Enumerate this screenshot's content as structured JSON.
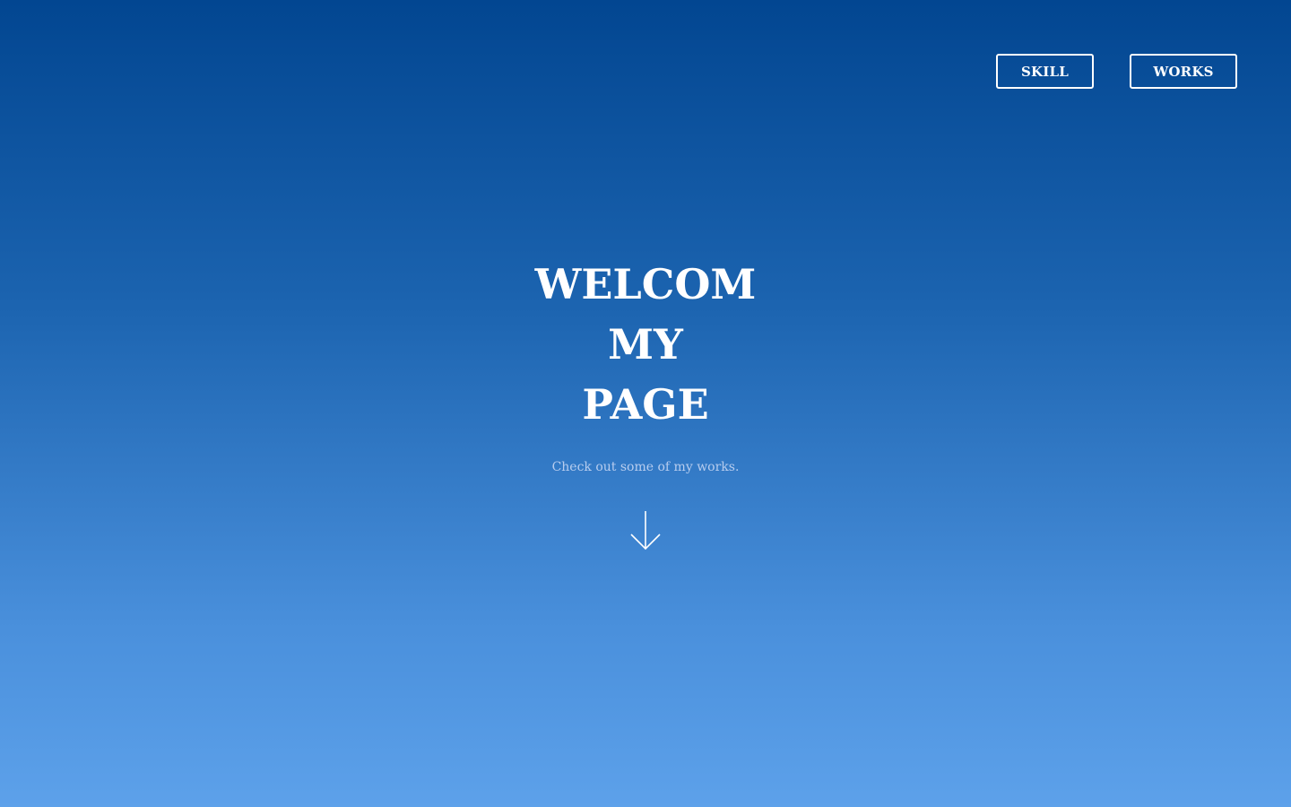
{
  "nav": {
    "skill_label": "SKILL",
    "works_label": "WORKS"
  },
  "hero": {
    "title_lines": [
      "WELCOM",
      "MY",
      "PAGE"
    ],
    "subtitle": "Check out some of my works."
  },
  "icons": {
    "scroll": "arrow-down-icon"
  },
  "colors": {
    "gradient_top": "#024691",
    "gradient_bottom": "#5da1ea",
    "text": "#ffffff",
    "subtitle": "#b7cdef"
  }
}
